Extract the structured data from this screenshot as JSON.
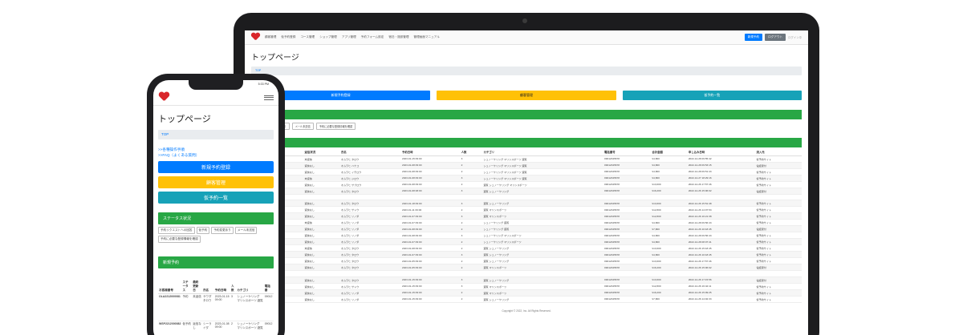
{
  "laptop": {
    "nav": {
      "menu": [
        "顧客管理",
        "仮予約登録",
        "コース管理",
        "ショップ管理",
        "アプリ管理",
        "予約フォーム設定",
        "宿泊・施設管理",
        "管理画面マニュアル"
      ],
      "buttons": [
        "新規予約",
        "ログアウト"
      ],
      "user": "ログイン中"
    },
    "title": "トップページ",
    "breadcrumb": "TOP",
    "links": [
      "操作手順",
      "よくある質問"
    ],
    "buttons": {
      "new": "新規予約登録",
      "customers": "顧客管理",
      "temp": "仮予約一覧"
    },
    "status_chips": [
      "仮予約",
      "予約変更あり",
      "メール未送信",
      "予約に必要な登録情報を確認"
    ],
    "table": {
      "headers": [
        "",
        "ステータス",
        "返信状況",
        "氏名",
        "予約日時",
        "人数",
        "カテゴリ",
        "電話番号",
        "合計金額",
        "申し込み日時",
        "流入元"
      ],
      "rows": [
        [
          "",
          "予約",
          "未返信",
          "オムラヒ タロウ",
          "2023-01-15 09:00",
          "3",
          "シュノーケリング マリンスポーツ 遊覧",
          "09012345678",
          "¥4,800",
          "2022-12-28 09:55:42",
          "仮予約サイト"
        ],
        [
          "",
          "仮予約",
          "返信なし",
          "オムラヒ ハナコ",
          "2023-01-08 09:00",
          "2",
          "シュノーケリング マリンスポーツ 遊覧",
          "09012345678",
          "¥4,800",
          "2022-12-28 09:53:15",
          "電話受付"
        ],
        [
          "",
          "予約",
          "返信なし",
          "オムラヒ イチロウ",
          "2023-01-08 09:00",
          "2",
          "シュノーケリング マリンスポーツ 遊覧",
          "09012345678",
          "¥4,800",
          "2022-12-28 09:51:43",
          "仮予約サイト"
        ],
        [
          "",
          "キャンセル",
          "未返信",
          "オムラヒ ジロウ",
          "2023-01-08 09:00",
          "3",
          "シュノーケリング マリンスポーツ 遊覧",
          "09012345678",
          "¥4,800",
          "2022-12-27 18:29:16",
          "仮予約サイト"
        ],
        [
          "",
          "予約",
          "返信なし",
          "オムラヒ サブロウ",
          "2023-01-08 09:00",
          "2",
          "遊覧 シュノーケリング マリンスポーツ",
          "09012345678",
          "¥13,600",
          "2022-12-26 17:57:46",
          "仮予約サイト"
        ],
        [
          "",
          "予約",
          "返信なし",
          "オムラヒ タロウ",
          "2023-01-08 08:00",
          "3",
          "遊覧 シュノーケリング",
          "09012345678",
          "¥16,200",
          "2022-12-26 15:06:02",
          "電話受付"
        ],
        [
          "",
          "",
          "",
          "",
          "",
          "",
          "",
          "",
          "",
          "",
          ""
        ],
        [
          "",
          "予約",
          "返信なし",
          "オムラヒ タロウ",
          "2023-01-18 09:00",
          "3",
          "遊覧 シュノーケリング",
          "09012345678",
          "¥13,600",
          "2022-12-26 15:51:48",
          "仮予約サイト"
        ],
        [
          "",
          "キャンセル",
          "返信なし",
          "オムラヒ サトウ",
          "2023-01-11 09:00",
          "2",
          "遊覧 マリンスポーツ",
          "09012345678",
          "¥12,800",
          "2022-12-26 14:07:53",
          "仮予約サイト"
        ],
        [
          "",
          "予約",
          "返信なし",
          "オムラヒ ソノダ",
          "2023-01-07 09:00",
          "3",
          "遊覧 マリンスポーツ",
          "09012345678",
          "¥12,800",
          "2022-12-26 16:21:38",
          "仮予約サイト"
        ],
        [
          "",
          "予約",
          "未返信",
          "オムラヒ ソノダ",
          "2023-01-07 09:00",
          "2",
          "シュノーケリング 遊覧",
          "09012345678",
          "¥4,800",
          "2022-12-28 09:56:43",
          "仮予約サイト"
        ],
        [
          "",
          "予約",
          "返信なし",
          "オムラヒ ソノダ",
          "2023-01-08 09:00",
          "2",
          "シュノーケリング 遊覧",
          "09012345678",
          "¥7,800",
          "2022-12-26 10:18:45",
          "電話受付"
        ],
        [
          "",
          "予約",
          "返信なし",
          "オムラヒ ソノダ",
          "2023-01-08 09:00",
          "3",
          "シュノーケリング マリンスポーツ",
          "09012345678",
          "¥4,800",
          "2022-12-28 09:56:43",
          "仮予約サイト"
        ],
        [
          "",
          "予約",
          "返信なし",
          "オムラヒ ソノダ",
          "2023-01-07 09:00",
          "2",
          "シュノーケリング マリンスポーツ",
          "09012345678",
          "¥4,800",
          "2022-12-28 08:07:41",
          "仮予約サイト"
        ],
        [
          "",
          "キャンセル",
          "未返信",
          "オムラヒ タロウ",
          "2023-01-08 09:00",
          "2",
          "遊覧 シュノーケリング",
          "09012345678",
          "¥13,600",
          "2022-12-26 15:18:45",
          "仮予約サイト"
        ],
        [
          "",
          "予約",
          "返信なし",
          "オムラヒ タロウ",
          "2023-01-07 09:00",
          "3",
          "遊覧 シュノーケリング",
          "09012345678",
          "¥4,800",
          "2022-12-26 10:18:45",
          "仮予約サイト"
        ],
        [
          "",
          "予約",
          "返信なし",
          "オムラヒ タロウ",
          "2023-01-05 09:00",
          "2",
          "遊覧 シュノーケリング",
          "09012345678",
          "¥13,600",
          "2022-12-26 17:57:46",
          "仮予約サイト"
        ],
        [
          "",
          "予約",
          "返信なし",
          "オムラヒ タロウ",
          "2023-01-05 09:00",
          "2",
          "遊覧 マリンスポーツ",
          "09012345678",
          "¥16,200",
          "2022-12-26 15:06:02",
          "電話受付"
        ],
        [
          "",
          "",
          "",
          "",
          "",
          "",
          "",
          "",
          "",
          "",
          ""
        ],
        [
          "",
          "予約",
          "返信なし",
          "オムラヒ タロウ",
          "2023-01-15 09:00",
          "3",
          "遊覧 シュノーケリング",
          "09012345678",
          "¥13,600",
          "2022-12-26 17:15:56",
          "電話受付"
        ],
        [
          "",
          "キャンセル",
          "返信なし",
          "オムラヒ サトウ",
          "2023-01-15 09:00",
          "3",
          "遊覧 マリンスポーツ",
          "09012345678",
          "¥12,800",
          "2022-12-26 16:42:11",
          "仮予約サイト"
        ],
        [
          "",
          "予約",
          "返信なし",
          "オムラヒ ソノダ",
          "2023-01-15 09:00",
          "2",
          "遊覧 マリンスポーツ",
          "09012345678",
          "¥16,200",
          "2022-12-26 15:09:25",
          "仮予約サイト"
        ],
        [
          "",
          "予約",
          "返信なし",
          "オムラヒ ソノダ",
          "2023-01-15 09:00",
          "2",
          "遊覧 シュノーケリング",
          "09012345678",
          "¥7,800",
          "2022-12-26 14:02:33",
          "仮予約サイト"
        ]
      ]
    },
    "footer": "Copyright © 2022, Inc. All Rights Reserved."
  },
  "phone": {
    "status_time": "5:33 PM",
    "title": "トップページ",
    "breadcrumb": "TOP",
    "links": [
      ">>各種操作手順",
      ">>FAQ（よくある質問）"
    ],
    "buttons": {
      "new": "新規予約登録",
      "customers": "顧客管理",
      "temp": "仮予約一覧"
    },
    "status_header": "ステータス状況",
    "status_chips": [
      "予約リクエストへの回答",
      "仮予約",
      "予約変更あり",
      "メール未送信",
      "予約に必要な登録情報を確認"
    ],
    "new_header": "新規予約",
    "table": {
      "headers": [
        "お客様番号",
        "ステータス",
        "最終更新日",
        "氏名",
        "予約日時",
        "人数",
        "カテゴリ",
        "電話番"
      ],
      "rows": [
        [
          "OLA2212000081",
          "予約",
          "未返信",
          "サワダ タロウ",
          "2023-01-15 09:00",
          "3",
          "シュノーケリング マリンスポーツ 遊覧",
          "09012"
        ],
        [
          "WSP2212000082",
          "仮予約",
          "返信なし",
          "シーライダ",
          "2023-01-08 09:00",
          "2",
          "シュノーケリング マリンスポーツ 遊覧",
          "09012"
        ]
      ]
    }
  },
  "colors": {
    "blue": "#007bff",
    "yellow": "#ffc107",
    "teal": "#17a2b8",
    "green": "#28a745",
    "brand": "#d9262b"
  }
}
